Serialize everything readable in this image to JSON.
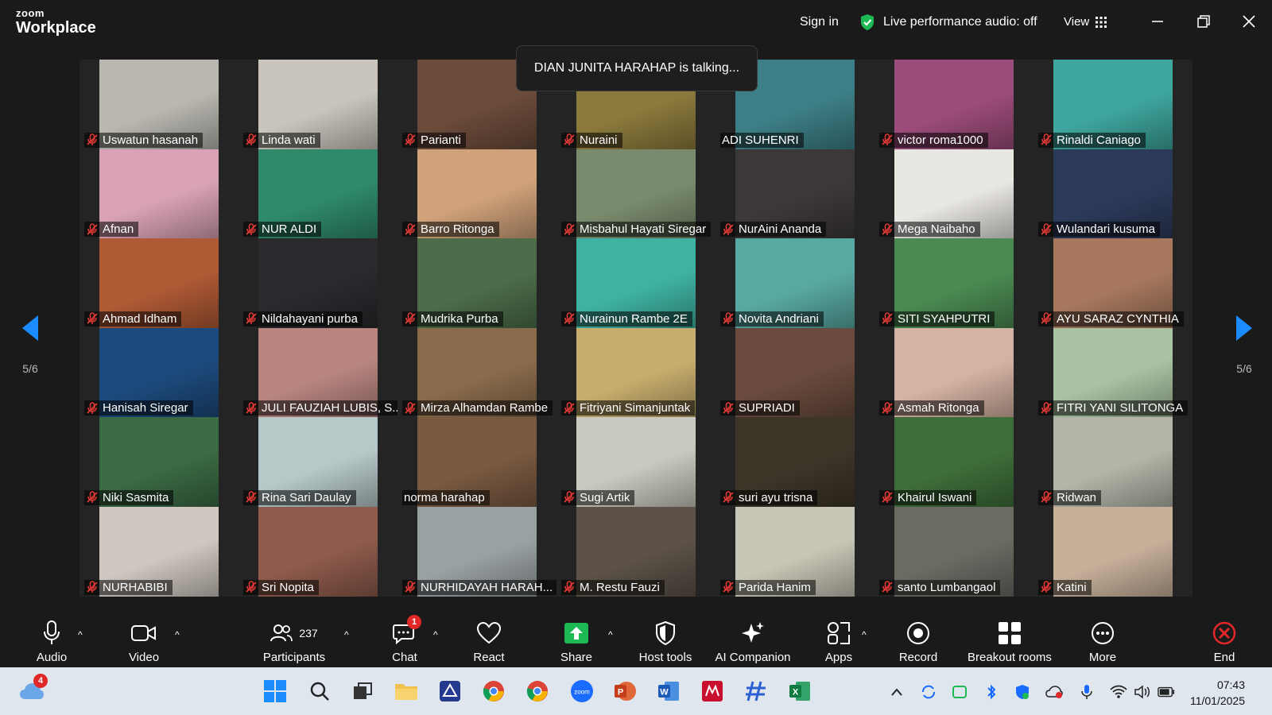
{
  "titlebar": {
    "brand_small": "zoom",
    "brand_large": "Workplace",
    "sign_in": "Sign in",
    "live_audio": "Live performance audio: off",
    "view": "View"
  },
  "talking_banner": "DIAN JUNITA HARAHAP is talking...",
  "pagination": {
    "left": "5/6",
    "right": "5/6"
  },
  "participants_grid": [
    {
      "name": "Uswatun hasanah",
      "muted": true,
      "bg": "#b9b7b0"
    },
    {
      "name": "Linda wati",
      "muted": true,
      "bg": "#c9c5bd"
    },
    {
      "name": "Parianti",
      "muted": true,
      "bg": "#6b4b3a"
    },
    {
      "name": "Nuraini",
      "muted": true,
      "bg": "#8c7a3c"
    },
    {
      "name": "ADI SUHENRI",
      "muted": false,
      "bg": "#3d7f86"
    },
    {
      "name": "victor roma1000",
      "muted": true,
      "bg": "#9c4c7a"
    },
    {
      "name": "Rinaldi Caniago",
      "muted": true,
      "bg": "#3ea69e"
    },
    {
      "name": "Afnan",
      "muted": true,
      "bg": "#d9a2b6"
    },
    {
      "name": "NUR ALDI",
      "muted": true,
      "bg": "#2f8a6c"
    },
    {
      "name": "Barro Ritonga",
      "muted": true,
      "bg": "#d0a27a"
    },
    {
      "name": "Misbahul Hayati Siregar",
      "muted": true,
      "bg": "#7a8b6d"
    },
    {
      "name": "NurAini Ananda",
      "muted": true,
      "bg": "#3c3838"
    },
    {
      "name": "Mega Naibaho",
      "muted": true,
      "bg": "#e9e7e2"
    },
    {
      "name": "Wulandari kusuma",
      "muted": true,
      "bg": "#2c3a5a"
    },
    {
      "name": "Ahmad Idham",
      "muted": true,
      "bg": "#b05a35"
    },
    {
      "name": "Nildahayani purba",
      "muted": true,
      "bg": "#2a2a2e"
    },
    {
      "name": "Mudrika Purba",
      "muted": true,
      "bg": "#4c6d4a"
    },
    {
      "name": "Nurainun Rambe 2E",
      "muted": true,
      "bg": "#3fb3a3"
    },
    {
      "name": "Novita Andriani",
      "muted": true,
      "bg": "#59a9a3"
    },
    {
      "name": "SITI SYAHPUTRI",
      "muted": true,
      "bg": "#4b8a52"
    },
    {
      "name": "AYU SARAZ CYNTHIA",
      "muted": true,
      "bg": "#a7785e"
    },
    {
      "name": "Hanisah Siregar",
      "muted": true,
      "bg": "#1d4a7c"
    },
    {
      "name": "JULI FAUZIAH LUBIS, S...",
      "muted": true,
      "bg": "#b88580"
    },
    {
      "name": "Mirza Alhamdan Rambe",
      "muted": true,
      "bg": "#8a6b4c"
    },
    {
      "name": "Fitriyani Simanjuntak",
      "muted": true,
      "bg": "#c7ad6d"
    },
    {
      "name": "SUPRIADI",
      "muted": true,
      "bg": "#6a4b3d"
    },
    {
      "name": "Asmah Ritonga",
      "muted": true,
      "bg": "#d5b3a3"
    },
    {
      "name": "FITRI YANI SILITONGA",
      "muted": true,
      "bg": "#a9c2a2"
    },
    {
      "name": "Niki Sasmita",
      "muted": true,
      "bg": "#3b6b44"
    },
    {
      "name": "Rina Sari Daulay",
      "muted": true,
      "bg": "#b7c8c9"
    },
    {
      "name": "norma harahap",
      "muted": false,
      "bg": "#7a5a41"
    },
    {
      "name": "Sugi Artik",
      "muted": true,
      "bg": "#c9c9c0"
    },
    {
      "name": "suri ayu trisna",
      "muted": true,
      "bg": "#3d3528"
    },
    {
      "name": "Khairul Iswani",
      "muted": true,
      "bg": "#3e6e3a"
    },
    {
      "name": "Ridwan",
      "muted": true,
      "bg": "#b3b5a8"
    },
    {
      "name": "NURHABIBI",
      "muted": true,
      "bg": "#cfc7c0"
    },
    {
      "name": "Sri Nopita",
      "muted": true,
      "bg": "#8e5b4c"
    },
    {
      "name": "NURHIDAYAH HARAH...",
      "muted": true,
      "bg": "#9aa1a3"
    },
    {
      "name": "M. Restu Fauzi",
      "muted": true,
      "bg": "#5c5248"
    },
    {
      "name": "Parida Hanim",
      "muted": true,
      "bg": "#c8c6b6"
    },
    {
      "name": "santo Lumbangaol",
      "muted": true,
      "bg": "#6b6a63"
    },
    {
      "name": "Katini",
      "muted": true,
      "bg": "#c7b09a"
    }
  ],
  "toolbar": {
    "audio": "Audio",
    "video": "Video",
    "participants": "Participants",
    "participants_count": "237",
    "chat": "Chat",
    "chat_badge": "1",
    "react": "React",
    "share": "Share",
    "host_tools": "Host tools",
    "ai_companion": "AI Companion",
    "apps": "Apps",
    "record": "Record",
    "breakout_rooms": "Breakout rooms",
    "more": "More",
    "end": "End"
  },
  "taskbar": {
    "weather_badge": "4",
    "time": "07:43",
    "date": "11/01/2025"
  },
  "colors": {
    "accent_blue": "#1a8cff",
    "share_green": "#1db954",
    "end_red": "#e02828",
    "mic_off_red": "#e53935"
  }
}
